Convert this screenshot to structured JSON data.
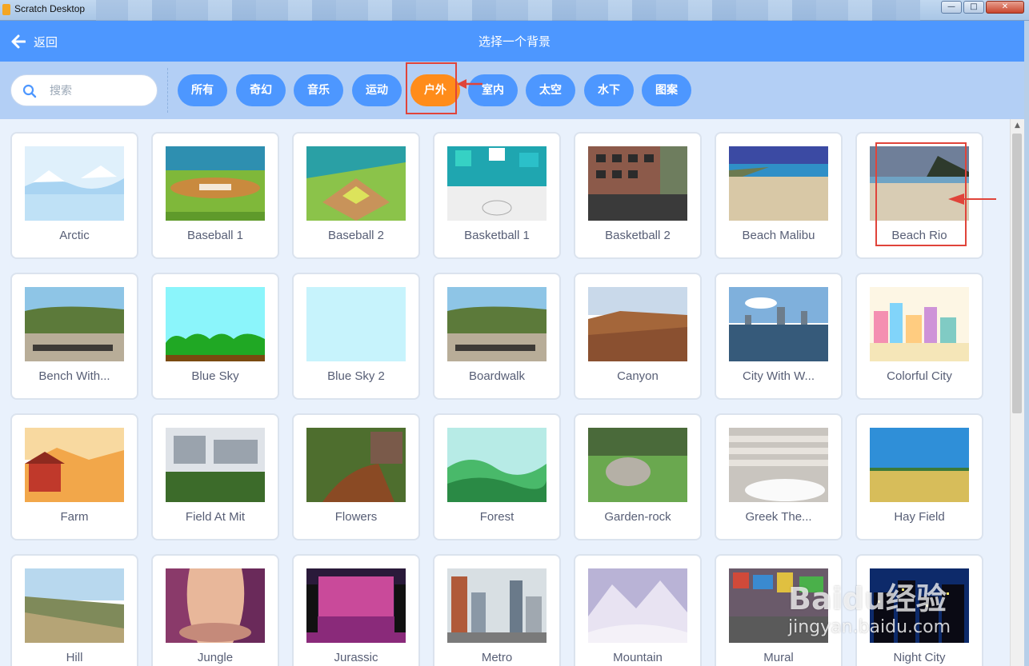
{
  "window": {
    "title": "Scratch Desktop",
    "minimize": "—",
    "maximize": "□",
    "close": "✕"
  },
  "header": {
    "back_label": "返回",
    "title": "选择一个背景"
  },
  "search": {
    "placeholder": "搜索",
    "value": ""
  },
  "tags": [
    {
      "label": "所有",
      "active": false
    },
    {
      "label": "奇幻",
      "active": false
    },
    {
      "label": "音乐",
      "active": false
    },
    {
      "label": "运动",
      "active": false
    },
    {
      "label": "户外",
      "active": true
    },
    {
      "label": "室内",
      "active": false
    },
    {
      "label": "太空",
      "active": false
    },
    {
      "label": "水下",
      "active": false
    },
    {
      "label": "图案",
      "active": false
    }
  ],
  "backdrops": [
    {
      "name": "Arctic"
    },
    {
      "name": "Baseball 1"
    },
    {
      "name": "Baseball 2"
    },
    {
      "name": "Basketball 1"
    },
    {
      "name": "Basketball 2"
    },
    {
      "name": "Beach Malibu"
    },
    {
      "name": "Beach Rio"
    },
    {
      "name": "Bench With..."
    },
    {
      "name": "Blue Sky"
    },
    {
      "name": "Blue Sky 2"
    },
    {
      "name": "Boardwalk"
    },
    {
      "name": "Canyon"
    },
    {
      "name": "City With W..."
    },
    {
      "name": "Colorful City"
    },
    {
      "name": "Farm"
    },
    {
      "name": "Field At Mit"
    },
    {
      "name": "Flowers"
    },
    {
      "name": "Forest"
    },
    {
      "name": "Garden-rock"
    },
    {
      "name": "Greek The..."
    },
    {
      "name": "Hay Field"
    },
    {
      "name": "Hill"
    },
    {
      "name": "Jungle"
    },
    {
      "name": "Jurassic"
    },
    {
      "name": "Metro"
    },
    {
      "name": "Mountain"
    },
    {
      "name": "Mural"
    },
    {
      "name": "Night City"
    }
  ],
  "watermark": {
    "brand": "Baidu经验",
    "url": "jingyan.baidu.com"
  },
  "colors": {
    "header": "#4d97ff",
    "filterbar": "#b3cff5",
    "active_tag": "#ff8c1a",
    "tag": "#4d97ff",
    "annotation": "#e0443a"
  }
}
